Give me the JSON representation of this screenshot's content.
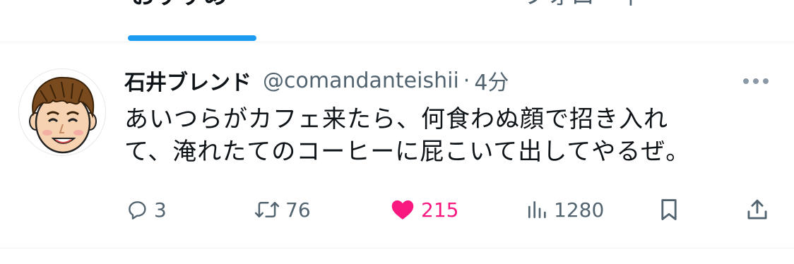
{
  "tabs": {
    "recommend_label": "おすすめ",
    "following_label": "フォロー中"
  },
  "tweet": {
    "display_name": "石井ブレンド",
    "handle": "@comandanteishii",
    "separator": "·",
    "time": "4分",
    "text_lines": [
      "あいつらがカフェ来たら、何食わぬ顔で招き入れ",
      "て、淹れたてのコーヒーに屁こいて出してやるぜ。"
    ],
    "actions": {
      "reply_count": "3",
      "retweet_count": "76",
      "like_count": "215",
      "views_count": "1280"
    }
  },
  "colors": {
    "accent": "#1d9bf0",
    "like": "#f91880",
    "secondary_text": "#536471",
    "divider": "#eff3f4"
  },
  "icons": {
    "more": "more-dots-icon",
    "reply": "reply-bubble-icon",
    "retweet": "retweet-icon",
    "like": "heart-filled-icon",
    "views": "views-chart-icon",
    "bookmark": "bookmark-icon",
    "share": "share-icon"
  }
}
